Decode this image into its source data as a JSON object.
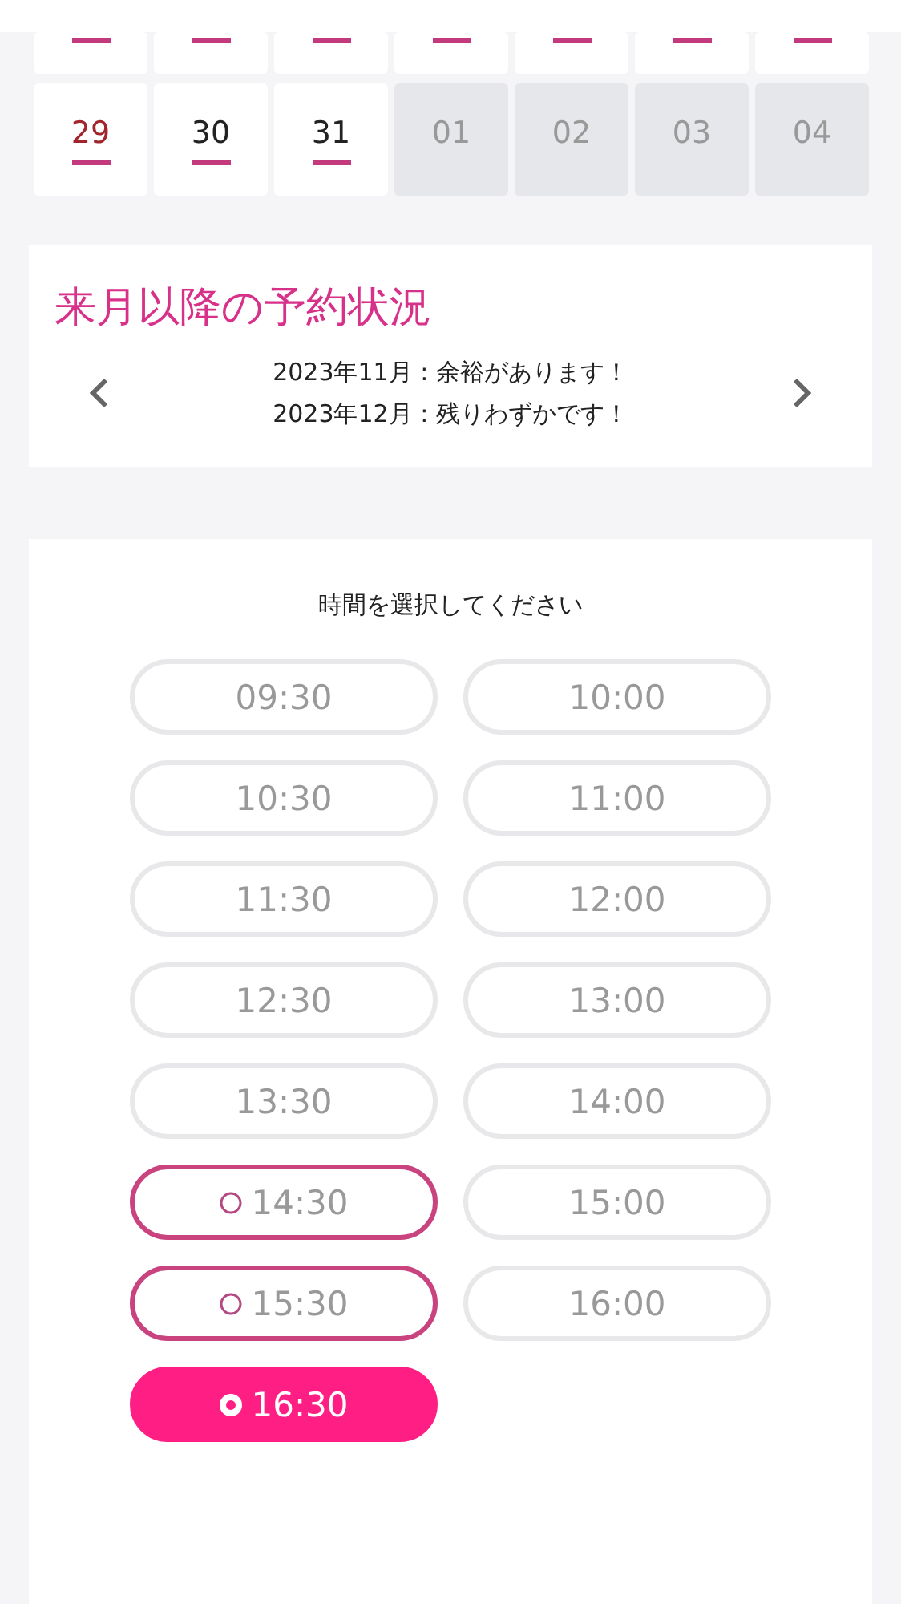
{
  "calendar": {
    "rows": [
      {
        "cells": [
          {
            "kind": "day",
            "marked": true
          },
          {
            "kind": "day",
            "marked": true
          },
          {
            "kind": "day",
            "marked": true
          },
          {
            "kind": "day",
            "marked": true
          },
          {
            "kind": "day",
            "marked": true
          },
          {
            "kind": "day",
            "marked": true
          },
          {
            "kind": "day",
            "marked": true
          }
        ]
      },
      {
        "cells": [
          {
            "kind": "holiday",
            "day": "29",
            "marked": true
          },
          {
            "kind": "day",
            "day": "30",
            "marked": true
          },
          {
            "kind": "day",
            "day": "31",
            "marked": true
          },
          {
            "kind": "outside",
            "day": "01",
            "marked": false
          },
          {
            "kind": "outside",
            "day": "02",
            "marked": false
          },
          {
            "kind": "outside",
            "day": "03",
            "marked": false
          },
          {
            "kind": "outside",
            "day": "04",
            "marked": false
          }
        ]
      }
    ]
  },
  "future_status": {
    "title": "来月以降の予約状況",
    "lines": [
      "2023年11月 : 余裕があります！",
      "2023年12月 : 残りわずかです！"
    ]
  },
  "time_select": {
    "title": "時間を選択してください",
    "slots": [
      {
        "label": "09:30",
        "disabled": true,
        "selected": false
      },
      {
        "label": "10:00",
        "disabled": true,
        "selected": false
      },
      {
        "label": "10:30",
        "disabled": true,
        "selected": false
      },
      {
        "label": "11:00",
        "disabled": true,
        "selected": false
      },
      {
        "label": "11:30",
        "disabled": true,
        "selected": false
      },
      {
        "label": "12:00",
        "disabled": true,
        "selected": false
      },
      {
        "label": "12:30",
        "disabled": true,
        "selected": false
      },
      {
        "label": "13:00",
        "disabled": true,
        "selected": false
      },
      {
        "label": "13:30",
        "disabled": true,
        "selected": false
      },
      {
        "label": "14:00",
        "disabled": true,
        "selected": false
      },
      {
        "label": "14:30",
        "disabled": false,
        "selected": false
      },
      {
        "label": "15:00",
        "disabled": true,
        "selected": false
      },
      {
        "label": "15:30",
        "disabled": false,
        "selected": false
      },
      {
        "label": "16:00",
        "disabled": true,
        "selected": false
      },
      {
        "label": "16:30",
        "disabled": false,
        "selected": true
      }
    ]
  }
}
